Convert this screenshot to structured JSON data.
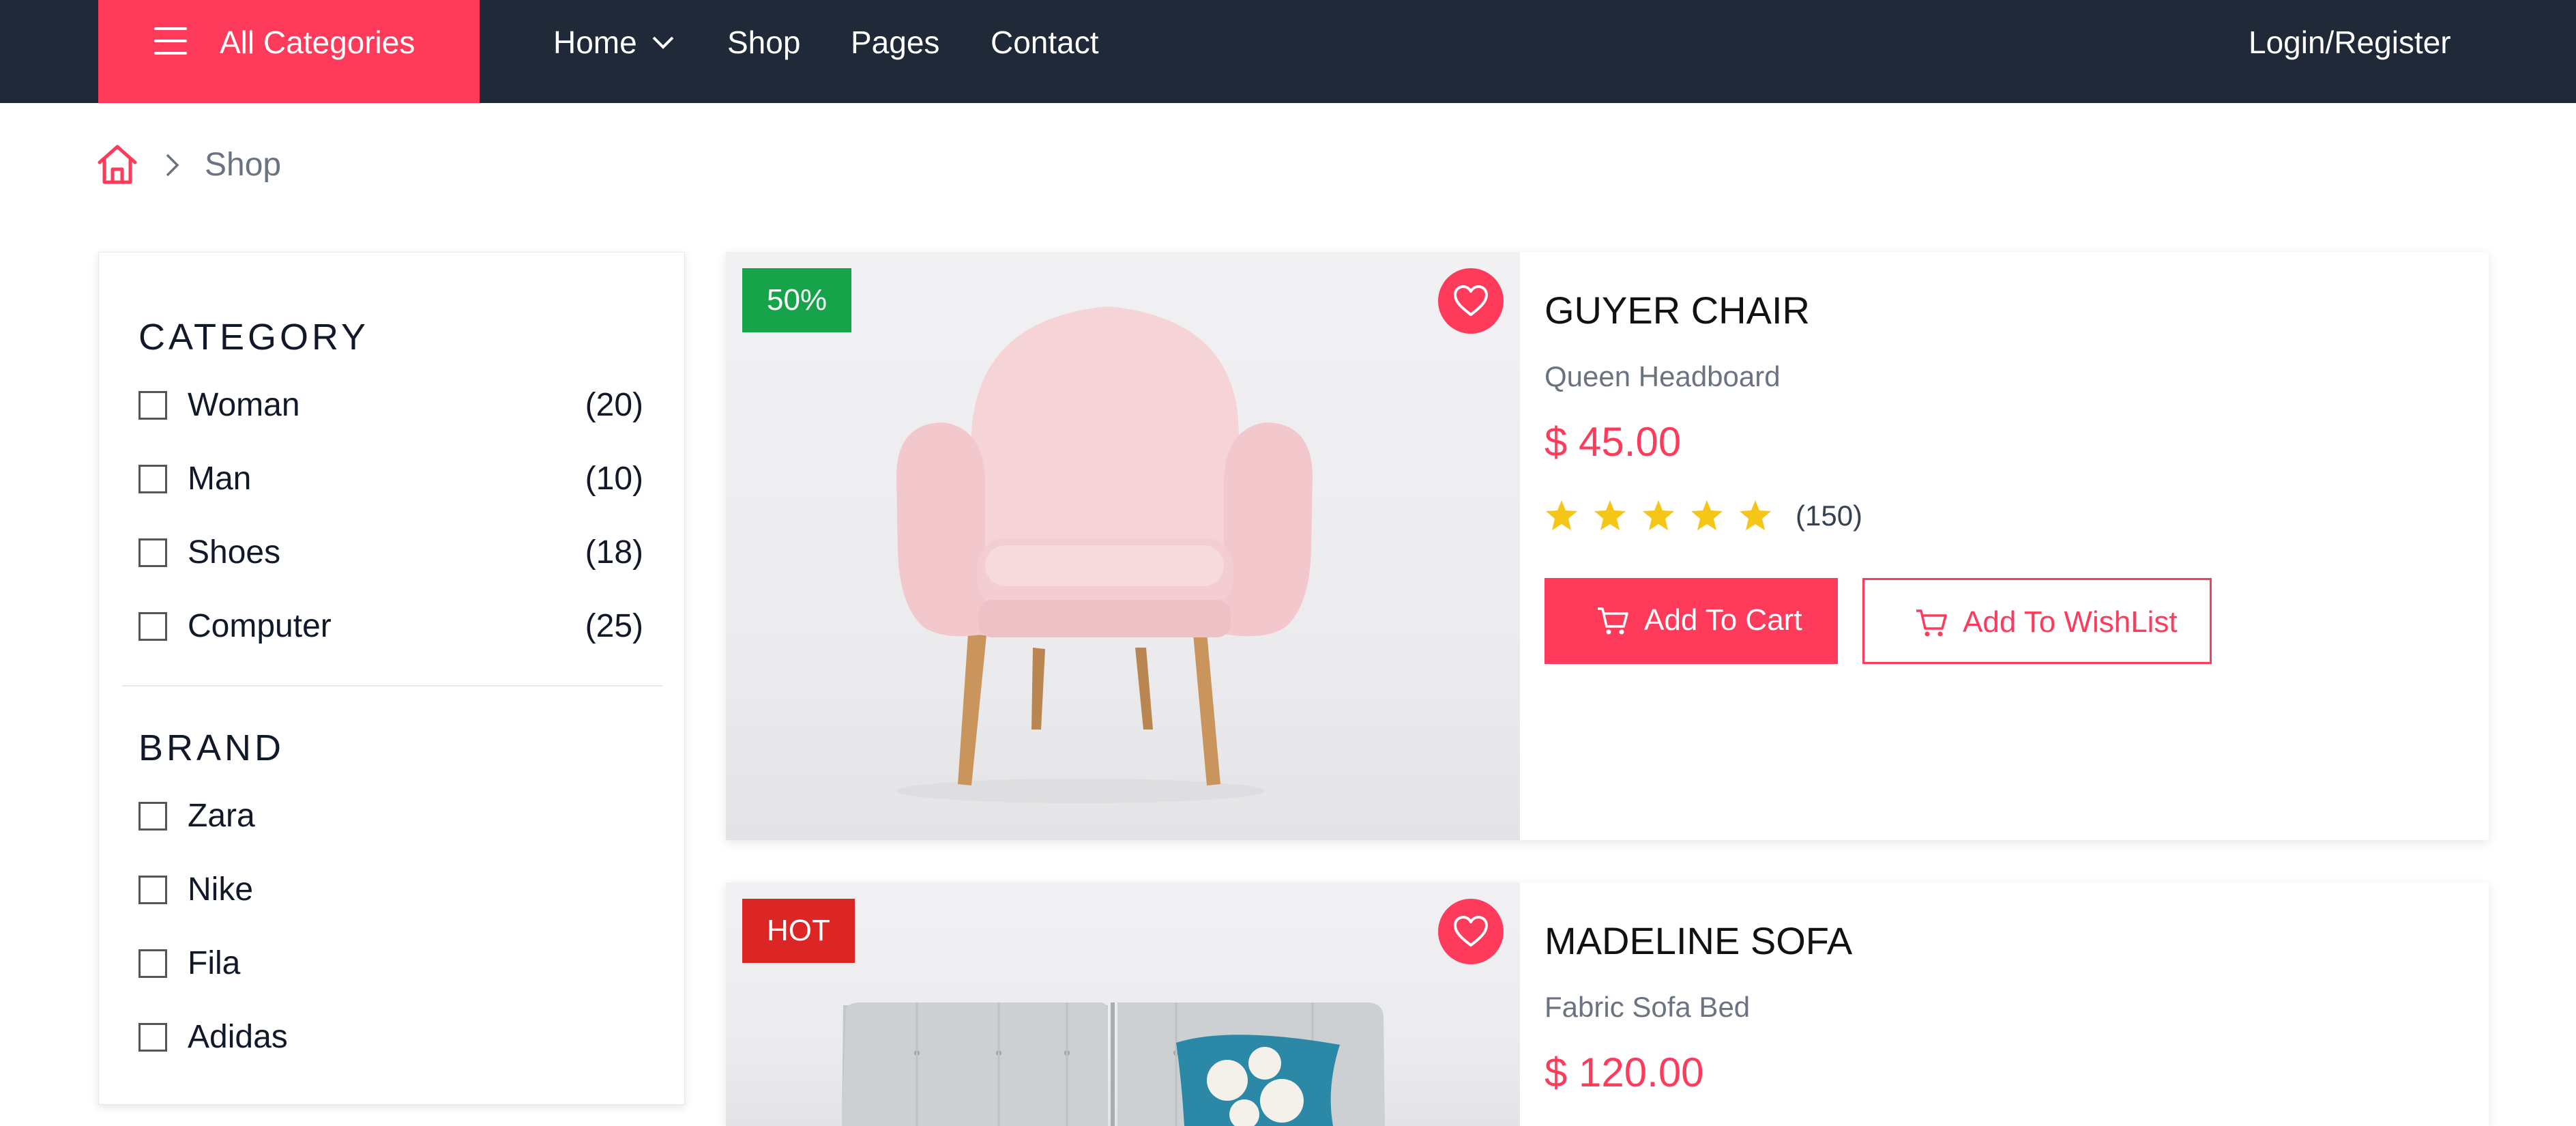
{
  "colors": {
    "accent": "#ff3b5c",
    "nav_bg": "#1f2937",
    "badge_green": "#16a34a",
    "badge_red": "#dc2626",
    "star": "#f5c518"
  },
  "topnav": {
    "categories_label": "All Categories",
    "links": [
      "Home",
      "Shop",
      "Pages",
      "Contact"
    ],
    "login_label": "Login/Register"
  },
  "breadcrumb": {
    "current": "Shop"
  },
  "sidebar": {
    "category": {
      "heading": "CATEGORY",
      "items": [
        {
          "label": "Woman",
          "count": "(20)"
        },
        {
          "label": "Man",
          "count": "(10)"
        },
        {
          "label": "Shoes",
          "count": "(18)"
        },
        {
          "label": "Computer",
          "count": "(25)"
        }
      ]
    },
    "brand": {
      "heading": "BRAND",
      "items": [
        {
          "label": "Zara"
        },
        {
          "label": "Nike"
        },
        {
          "label": "Fila"
        },
        {
          "label": "Adidas"
        }
      ]
    }
  },
  "products": [
    {
      "badge": "50%",
      "title": "GUYER CHAIR",
      "subtitle": "Queen Headboard",
      "price": "$ 45.00",
      "rating": 5,
      "rating_count": "(150)",
      "add_to_cart_label": "Add To Cart",
      "add_to_wishlist_label": "Add To WishList"
    },
    {
      "badge": "HOT",
      "title": "MADELINE SOFA",
      "subtitle": "Fabric Sofa Bed",
      "price": "$ 120.00"
    }
  ]
}
